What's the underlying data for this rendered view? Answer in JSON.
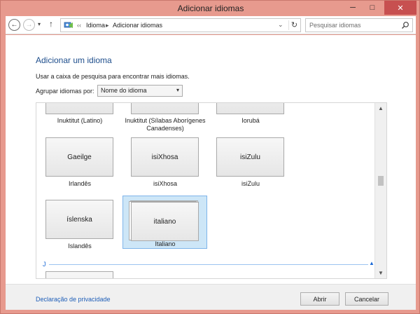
{
  "window": {
    "title": "Adicionar idiomas",
    "min_glyph": "─",
    "max_glyph": "□",
    "close_glyph": "✕"
  },
  "addressbar": {
    "back_glyph": "←",
    "forward_glyph": "→",
    "recent_glyph": "▾",
    "up_glyph": "↑",
    "more_glyph": "‹‹",
    "crumbs": [
      "Idioma",
      "Adicionar idiomas"
    ],
    "crumb_sep": "▸",
    "chevron_glyph": "⌄",
    "refresh_glyph": "↻",
    "search_placeholder": "Pesquisar idiomas"
  },
  "main": {
    "heading": "Adicionar um idioma",
    "hint": "Usar a caixa de pesquisa para encontrar mais idiomas.",
    "group_label": "Agrupar idiomas por:",
    "group_selected": "Nome do idioma",
    "group_arrow": "▾",
    "tiles_top_row": [
      {
        "caption": "Inuktitut (Latino)"
      },
      {
        "caption": "Inuktitut (Sílabas Aborígenes Canadenses)"
      },
      {
        "caption": "Iorubá"
      }
    ],
    "tiles_row2": [
      {
        "native": "Gaeilge",
        "caption": "Irlandês"
      },
      {
        "native": "isiXhosa",
        "caption": "isiXhosa"
      },
      {
        "native": "isiZulu",
        "caption": "isiZulu"
      }
    ],
    "tiles_row3": [
      {
        "native": "íslenska",
        "caption": "Islandês"
      },
      {
        "native": "italiano",
        "caption": "Italiano"
      }
    ],
    "section_letter": "J",
    "section_collapse_glyph": "▲",
    "scroll_up_glyph": "▲",
    "scroll_down_glyph": "▼"
  },
  "footer": {
    "privacy_link": "Declaração de privacidade",
    "open_label": "Abrir",
    "cancel_label": "Cancelar"
  },
  "colors": {
    "titlebar": "#e79a8e",
    "heading": "#1e4e8c",
    "selection_fill": "#cde6f7",
    "selection_border": "#7eb4ea",
    "link": "#1e5eb8"
  }
}
